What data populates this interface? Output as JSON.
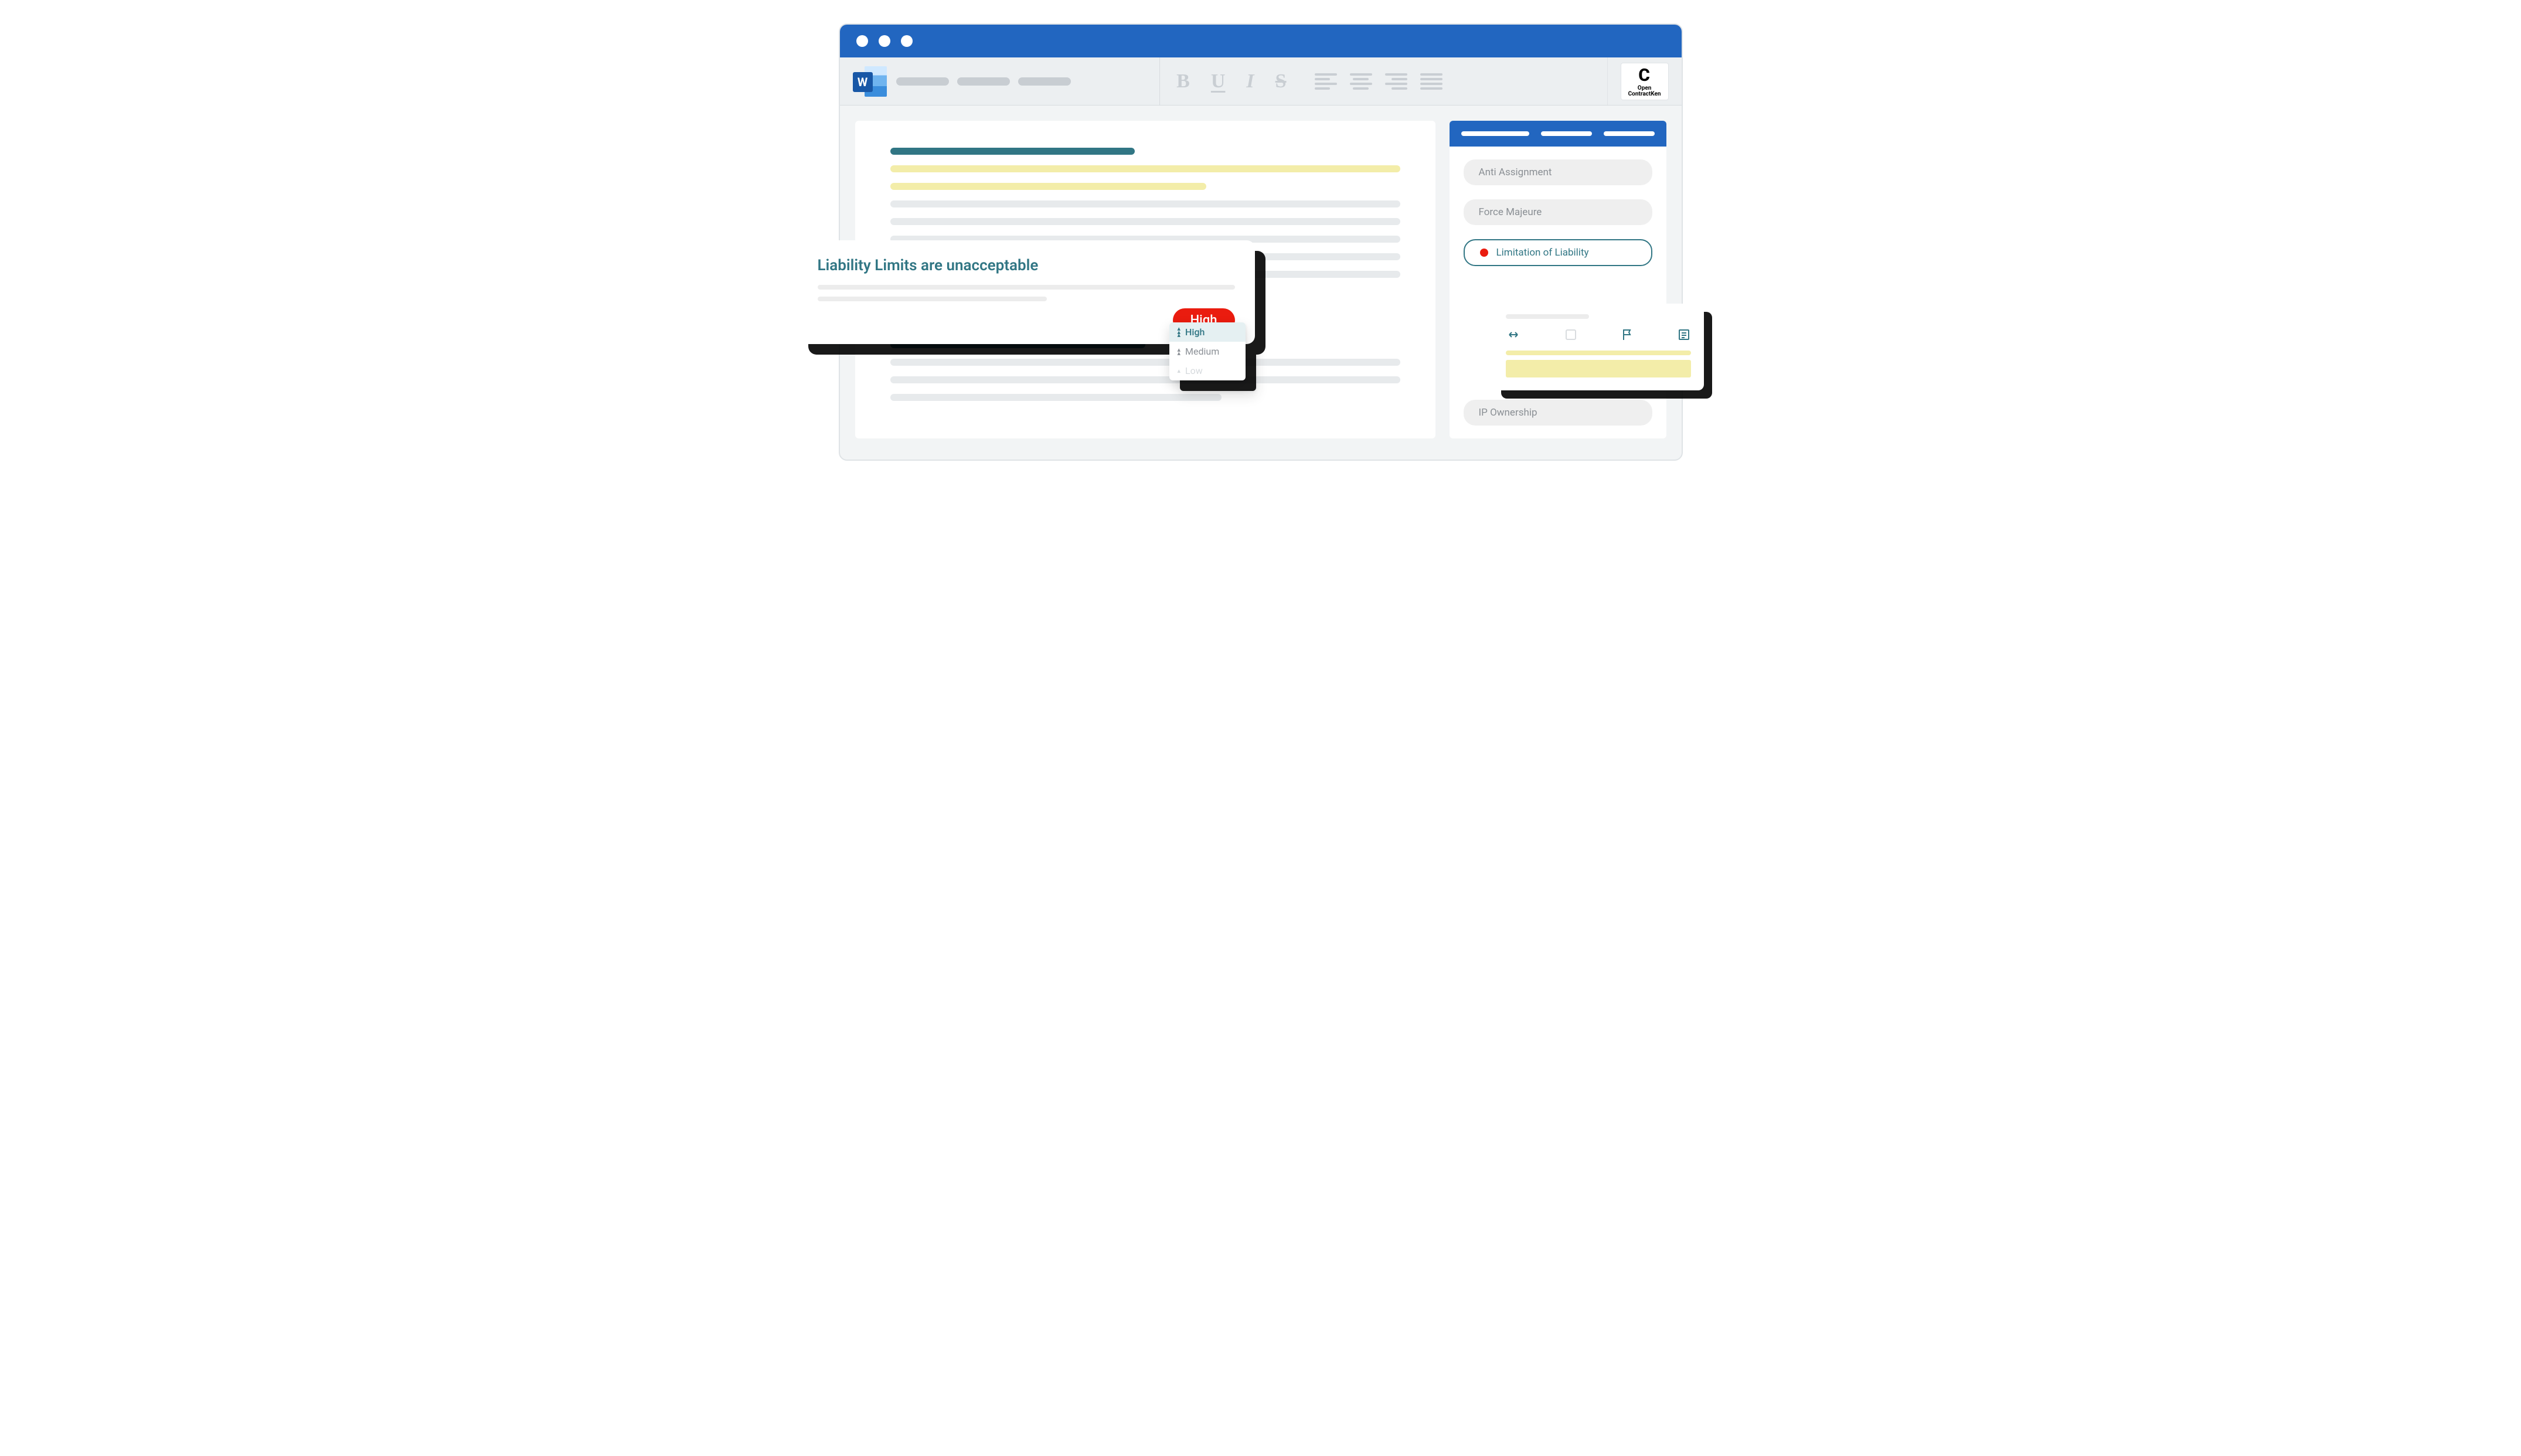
{
  "brand": {
    "symbol": "C",
    "line1": "Open",
    "line2": "ContractKen"
  },
  "ribbon": {
    "bold": "B",
    "underline": "U",
    "italic": "I",
    "strike": "S"
  },
  "word_icon_letter": "W",
  "popover": {
    "title": "Liability Limits are unacceptable",
    "risk_label": "High"
  },
  "risk_options": {
    "high": "High",
    "medium": "Medium",
    "low": "Low"
  },
  "clauses": {
    "0": "Anti Assignment",
    "1": "Force Majeure",
    "2": "Limitation of Liability",
    "3": "IP Ownership"
  },
  "colors": {
    "risk_dot": "#ea1c0f"
  }
}
